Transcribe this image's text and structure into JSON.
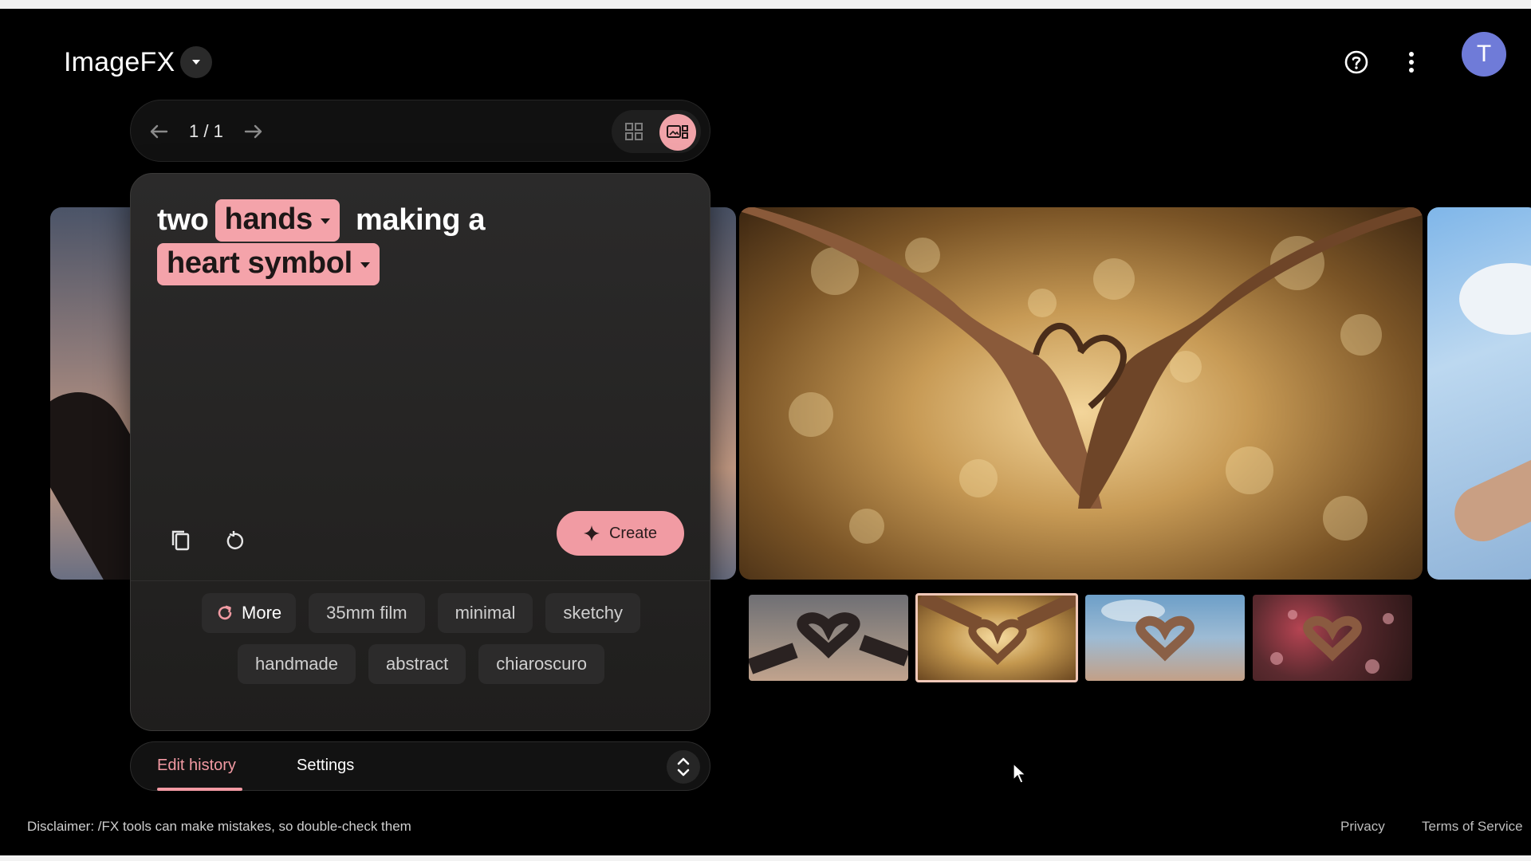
{
  "app": {
    "title": "ImageFX"
  },
  "header": {
    "help_icon": "help-circle-icon",
    "more_icon": "more-vert-icon",
    "avatar_initial": "T",
    "avatar_color": "#6f7bd8"
  },
  "pager": {
    "count": "1 / 1"
  },
  "prompt": {
    "word_1": "two",
    "chip_1": "hands",
    "word_2": "making a",
    "chip_2": "heart symbol",
    "create_label": "Create"
  },
  "style_chips": {
    "more_label": "More",
    "row1": [
      "35mm film",
      "minimal",
      "sketchy"
    ],
    "row2": [
      "handmade",
      "abstract",
      "chiaroscuro"
    ]
  },
  "tabs": {
    "edit_history": "Edit history",
    "settings": "Settings"
  },
  "footer": {
    "disclaimer": "Disclaimer: /FX tools can make mistakes, so double-check them",
    "privacy": "Privacy",
    "terms": "Terms of Service"
  },
  "colors": {
    "accent": "#f19ba3",
    "background": "#000000"
  }
}
